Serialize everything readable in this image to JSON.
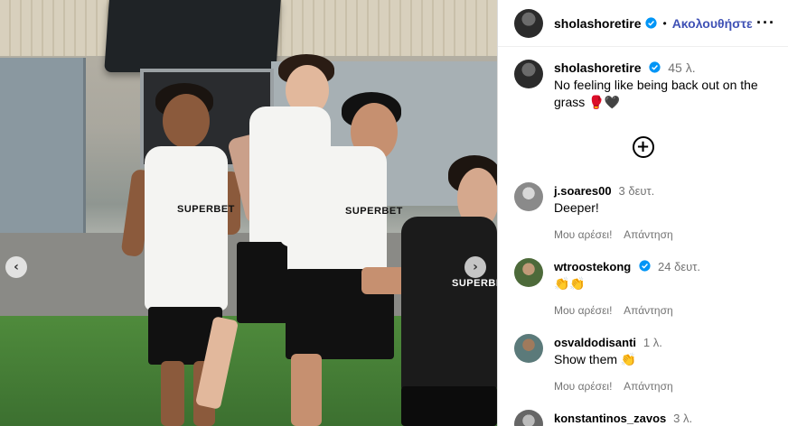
{
  "post": {
    "username": "sholashoretire",
    "follow_label": "Ακολουθήστε",
    "caption_user": "sholashoretire",
    "caption_time": "45 λ.",
    "caption_text": "No feeling like being back out on the grass",
    "caption_emoji": "🥊🖤"
  },
  "photo": {
    "sponsor_text": "SUPERBET",
    "prev_icon": "chevron-left-icon",
    "next_icon": "chevron-right-icon"
  },
  "comments": [
    {
      "user": "j.soares00",
      "time": "3 δευτ.",
      "text": "Deeper!",
      "verified": false,
      "like": "Μου αρέσει!",
      "reply": "Απάντηση"
    },
    {
      "user": "wtroostekong",
      "time": "24 δευτ.",
      "text": "👏👏",
      "verified": true,
      "like": "Μου αρέσει!",
      "reply": "Απάντηση"
    },
    {
      "user": "osvaldodisanti",
      "time": "1 λ.",
      "text": "Show them 👏",
      "verified": false,
      "like": "Μου αρέσει!",
      "reply": "Απάντηση"
    },
    {
      "user": "konstantinos_zavos",
      "time": "3 λ.",
      "text": "",
      "verified": false,
      "like": "",
      "reply": ""
    }
  ],
  "colors": {
    "verified": "#0095f6",
    "follow": "#3f51b5",
    "muted": "#737373"
  }
}
